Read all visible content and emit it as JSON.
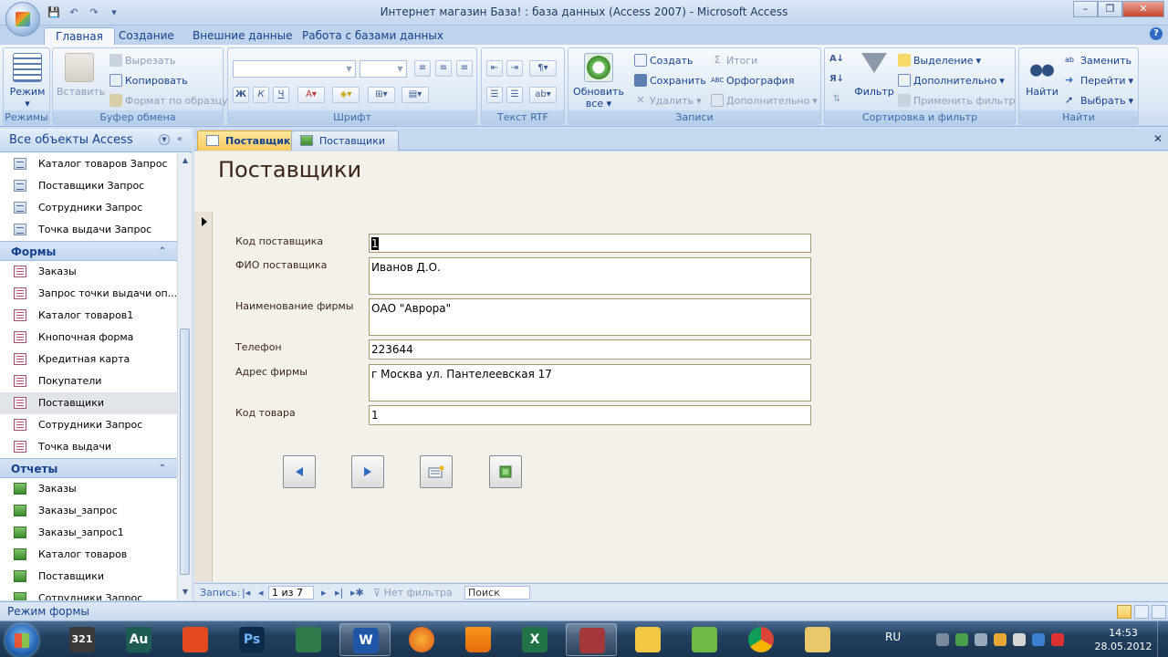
{
  "window": {
    "title": "Интернет магазин База! : база данных (Access 2007) - Microsoft Access"
  },
  "ribbon_tabs": [
    "Главная",
    "Создание",
    "Внешние данные",
    "Работа с базами данных"
  ],
  "ribbon": {
    "modes": {
      "view_label": "Режим",
      "group_label": "Режимы"
    },
    "clipboard": {
      "paste_label": "Вставить",
      "cut_label": "Вырезать",
      "copy_label": "Копировать",
      "format_painter_label": "Формат по образцу",
      "group_label": "Буфер обмена"
    },
    "font": {
      "bold": "Ж",
      "italic": "К",
      "underline": "Ч",
      "group_label": "Шрифт"
    },
    "rtf": {
      "group_label": "Текст RTF"
    },
    "records": {
      "refresh_label": "Обновить",
      "refresh_label2": "все",
      "new_label": "Создать",
      "save_label": "Сохранить",
      "delete_label": "Удалить",
      "totals_label": "Итоги",
      "spelling_label": "Орфография",
      "more_label": "Дополнительно",
      "group_label": "Записи"
    },
    "sort": {
      "filter_label": "Фильтр",
      "selection_label": "Выделение",
      "advanced_label": "Дополнительно",
      "apply_filter_label": "Применить фильтр",
      "group_label": "Сортировка и фильтр"
    },
    "find": {
      "find_label": "Найти",
      "replace_label": "Заменить",
      "goto_label": "Перейти",
      "select_label": "Выбрать",
      "group_label": "Найти"
    }
  },
  "nav_pane": {
    "header": "Все объекты Access",
    "top_items": [
      "Каталог товаров Запрос",
      "Поставщики Запрос",
      "Сотрудники Запрос",
      "Точка выдачи Запрос"
    ],
    "groups": [
      {
        "title": "Формы",
        "items": [
          "Заказы",
          "Запрос точки выдачи оп...",
          "Каталог товаров1",
          "Кнопочная форма",
          "Кредитная карта",
          "Покупатели",
          "Поставщики",
          "Сотрудники Запрос",
          "Точка выдачи"
        ]
      },
      {
        "title": "Отчеты",
        "items": [
          "Заказы",
          "Заказы_запрос",
          "Заказы_запрос1",
          "Каталог товаров",
          "Поставщики",
          "Сотрудники Запрос"
        ]
      }
    ],
    "selected": "Поставщики"
  },
  "doc_tabs": [
    "Поставщики",
    "Поставщики"
  ],
  "form": {
    "title": "Поставщики",
    "fields": [
      {
        "label": "Код поставщика",
        "value": "1"
      },
      {
        "label": "ФИО поставщика",
        "value": "Иванов Д.О."
      },
      {
        "label": "Наименование фирмы",
        "value": "ОАО \"Аврора\""
      },
      {
        "label": "Телефон",
        "value": "223644"
      },
      {
        "label": "Адрес фирмы",
        "value": "г Москва ул. Пантелеевская 17"
      },
      {
        "label": "Код товара",
        "value": "1"
      }
    ]
  },
  "record_nav": {
    "label": "Запись:",
    "position": "1 из 7",
    "filter": "Нет фильтра",
    "search": "Поиск"
  },
  "status": {
    "text": "Режим формы"
  },
  "taskbar": {
    "lang": "RU",
    "time": "14:53",
    "date": "28.05.2012",
    "apps": [
      "321",
      "Au",
      "",
      "Ps",
      "",
      "W",
      "",
      "",
      "X",
      "",
      "",
      "",
      "",
      ""
    ]
  },
  "colors": {
    "ribbon_accent": "#15428b",
    "active_tab": "#f7c95e",
    "form_bg": "#f4f1ea"
  }
}
